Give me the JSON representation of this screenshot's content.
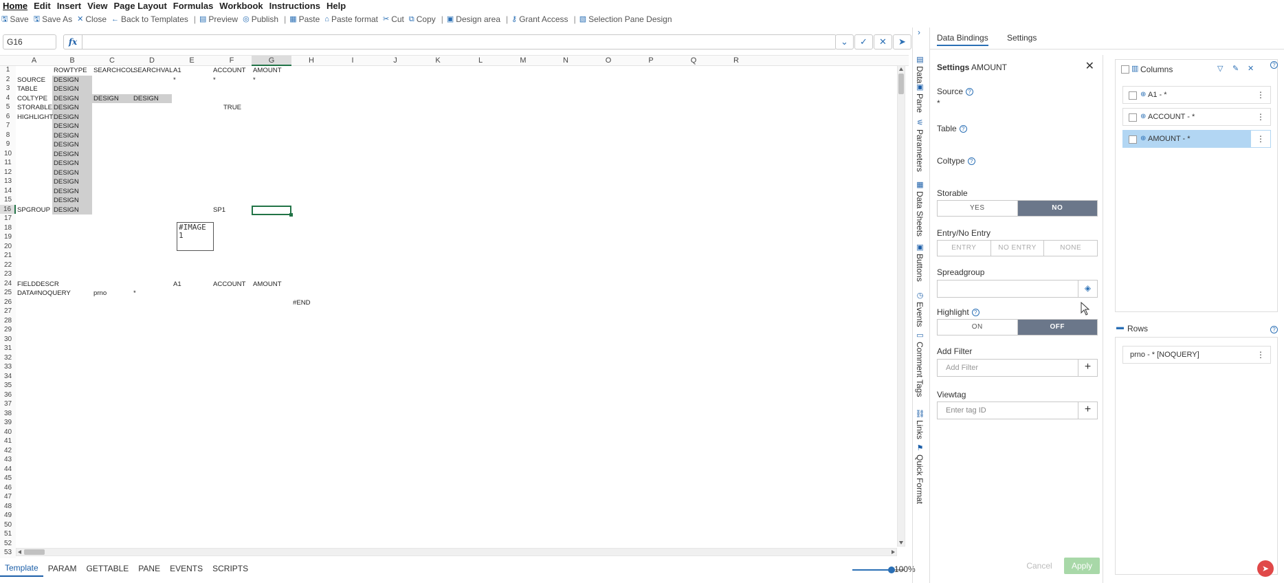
{
  "menu": [
    "Home",
    "Edit",
    "Insert",
    "View",
    "Page Layout",
    "Formulas",
    "Workbook",
    "Instructions",
    "Help"
  ],
  "toolbar": [
    {
      "label": "Save",
      "icon": "save-icon"
    },
    {
      "label": "Save As",
      "icon": "save-as-icon"
    },
    {
      "label": "Close",
      "icon": "close-icon"
    },
    {
      "label": "Back to Templates",
      "icon": "back-arrow-icon",
      "sep": true
    },
    {
      "label": "Preview",
      "icon": "preview-icon"
    },
    {
      "label": "Publish",
      "icon": "publish-icon",
      "sep": true
    },
    {
      "label": "Paste",
      "icon": "paste-icon"
    },
    {
      "label": "Paste format",
      "icon": "paste-format-icon"
    },
    {
      "label": "Cut",
      "icon": "cut-icon"
    },
    {
      "label": "Copy",
      "icon": "copy-icon",
      "sep": true
    },
    {
      "label": "Design area",
      "icon": "design-area-icon",
      "sep": true
    },
    {
      "label": "Grant Access",
      "icon": "grant-access-icon",
      "sep": true
    },
    {
      "label": "Selection Pane Design",
      "icon": "selection-pane-icon"
    }
  ],
  "formula": {
    "name_box": "G16",
    "fx_label": "fx",
    "value": ""
  },
  "columns": [
    "A",
    "B",
    "C",
    "D",
    "E",
    "F",
    "G",
    "H",
    "I",
    "J",
    "K",
    "L",
    "M",
    "N",
    "O",
    "P",
    "Q",
    "R"
  ],
  "selected_column": "G",
  "selected_row": 16,
  "row_count": 54,
  "cells": [
    {
      "r": 1,
      "c": "B",
      "v": "ROWTYPE"
    },
    {
      "r": 1,
      "c": "C",
      "v": "SEARCHCOL"
    },
    {
      "r": 1,
      "c": "D",
      "v": "SEARCHVAL"
    },
    {
      "r": 1,
      "c": "E",
      "v": "A1"
    },
    {
      "r": 1,
      "c": "F",
      "v": "ACCOUNT"
    },
    {
      "r": 1,
      "c": "G",
      "v": "AMOUNT"
    },
    {
      "r": 2,
      "c": "A",
      "v": "SOURCE"
    },
    {
      "r": 2,
      "c": "B",
      "v": "DESIGN"
    },
    {
      "r": 2,
      "c": "E",
      "v": "*"
    },
    {
      "r": 2,
      "c": "F",
      "v": "*"
    },
    {
      "r": 2,
      "c": "G",
      "v": "*"
    },
    {
      "r": 3,
      "c": "A",
      "v": "TABLE"
    },
    {
      "r": 3,
      "c": "B",
      "v": "DESIGN"
    },
    {
      "r": 4,
      "c": "A",
      "v": "COLTYPE"
    },
    {
      "r": 4,
      "c": "B",
      "v": "DESIGN"
    },
    {
      "r": 4,
      "c": "C",
      "v": "DESIGN"
    },
    {
      "r": 4,
      "c": "D",
      "v": "DESIGN"
    },
    {
      "r": 5,
      "c": "A",
      "v": "STORABLE"
    },
    {
      "r": 5,
      "c": "B",
      "v": "DESIGN"
    },
    {
      "r": 5,
      "c": "F",
      "v": "TRUE",
      "align": "center"
    },
    {
      "r": 6,
      "c": "A",
      "v": "HIGHLIGHT"
    },
    {
      "r": 6,
      "c": "B",
      "v": "DESIGN"
    },
    {
      "r": 7,
      "c": "B",
      "v": "DESIGN"
    },
    {
      "r": 8,
      "c": "B",
      "v": "DESIGN"
    },
    {
      "r": 9,
      "c": "B",
      "v": "DESIGN"
    },
    {
      "r": 10,
      "c": "B",
      "v": "DESIGN"
    },
    {
      "r": 11,
      "c": "B",
      "v": "DESIGN"
    },
    {
      "r": 12,
      "c": "B",
      "v": "DESIGN"
    },
    {
      "r": 13,
      "c": "B",
      "v": "DESIGN"
    },
    {
      "r": 14,
      "c": "B",
      "v": "DESIGN"
    },
    {
      "r": 15,
      "c": "B",
      "v": "DESIGN"
    },
    {
      "r": 16,
      "c": "A",
      "v": "SPGROUP"
    },
    {
      "r": 16,
      "c": "B",
      "v": "DESIGN"
    },
    {
      "r": 16,
      "c": "F",
      "v": "SP1"
    },
    {
      "r": 24,
      "c": "A",
      "v": "FIELDDESCR"
    },
    {
      "r": 24,
      "c": "E",
      "v": "A1"
    },
    {
      "r": 24,
      "c": "F",
      "v": "ACCOUNT"
    },
    {
      "r": 24,
      "c": "G",
      "v": "AMOUNT"
    },
    {
      "r": 25,
      "c": "A",
      "v": "DATA#NOQUERY"
    },
    {
      "r": 25,
      "c": "C",
      "v": "prno"
    },
    {
      "r": 25,
      "c": "D",
      "v": "*"
    },
    {
      "r": 26,
      "c": "H",
      "v": "#END"
    }
  ],
  "gray_cells": [
    {
      "r": 2,
      "c": "B"
    },
    {
      "r": 3,
      "c": "B"
    },
    {
      "r": 4,
      "c": "B"
    },
    {
      "r": 4,
      "c": "C"
    },
    {
      "r": 4,
      "c": "D"
    },
    {
      "r": 5,
      "c": "B"
    },
    {
      "r": 6,
      "c": "B"
    },
    {
      "r": 7,
      "c": "B"
    },
    {
      "r": 8,
      "c": "B"
    },
    {
      "r": 9,
      "c": "B"
    },
    {
      "r": 10,
      "c": "B"
    },
    {
      "r": 11,
      "c": "B"
    },
    {
      "r": 12,
      "c": "B"
    },
    {
      "r": 13,
      "c": "B"
    },
    {
      "r": 14,
      "c": "B"
    },
    {
      "r": 15,
      "c": "B"
    },
    {
      "r": 16,
      "c": "B"
    }
  ],
  "image_placeholder": {
    "line1": "#IMAGE",
    "line2": "1"
  },
  "sheet_tabs": [
    "Template",
    "PARAM",
    "GETTABLE",
    "PANE",
    "EVENTS",
    "SCRIPTS"
  ],
  "active_sheet": "Template",
  "zoom": {
    "label": "100%",
    "value": 0.75
  },
  "side_rail": [
    {
      "label": "Data",
      "icon": "data-icon"
    },
    {
      "label": "Pane",
      "icon": "pane-icon"
    },
    {
      "label": "Parameters",
      "icon": "parameters-icon"
    },
    {
      "label": "Data Sheets",
      "icon": "data-sheets-icon"
    },
    {
      "label": "Buttons",
      "icon": "buttons-icon"
    },
    {
      "label": "Events",
      "icon": "events-icon"
    },
    {
      "label": "Comment Tags",
      "icon": "comment-tags-icon"
    },
    {
      "label": "Links",
      "icon": "links-icon"
    },
    {
      "label": "Quick Format",
      "icon": "quick-format-icon"
    }
  ],
  "panel_tabs": {
    "data_bindings": "Data Bindings",
    "settings": "Settings",
    "active": "Data Bindings"
  },
  "settings": {
    "title_prefix": "Settings",
    "title_field": "AMOUNT",
    "source_label": "Source",
    "source_value": "*",
    "table_label": "Table",
    "coltype_label": "Coltype",
    "storable_label": "Storable",
    "storable_options": [
      "YES",
      "NO"
    ],
    "storable_selected": "NO",
    "entry_label": "Entry/No Entry",
    "entry_options": [
      "ENTRY",
      "NO ENTRY",
      "NONE"
    ],
    "spreadgroup_label": "Spreadgroup",
    "spreadgroup_value": "",
    "highlight_label": "Highlight",
    "highlight_options": [
      "ON",
      "OFF"
    ],
    "highlight_selected": "OFF",
    "add_filter_label": "Add Filter",
    "add_filter_placeholder": "Add Filter",
    "viewtag_label": "Viewtag",
    "viewtag_placeholder": "Enter tag ID",
    "cancel": "Cancel",
    "apply": "Apply"
  },
  "columns_panel": {
    "title": "Columns",
    "items": [
      {
        "label": "A1 - *",
        "selected": false
      },
      {
        "label": "ACCOUNT - *",
        "selected": false
      },
      {
        "label": "AMOUNT - *",
        "selected": true
      }
    ]
  },
  "rows_panel": {
    "title": "Rows",
    "items": [
      {
        "label": "prno - * [NOQUERY]"
      }
    ]
  },
  "colors": {
    "accent": "#2a6fb5",
    "selection_green": "#217346",
    "toggle_on": "#6b778a",
    "apply_green": "#a8d8a8",
    "selected_item": "#b2d6f3"
  }
}
